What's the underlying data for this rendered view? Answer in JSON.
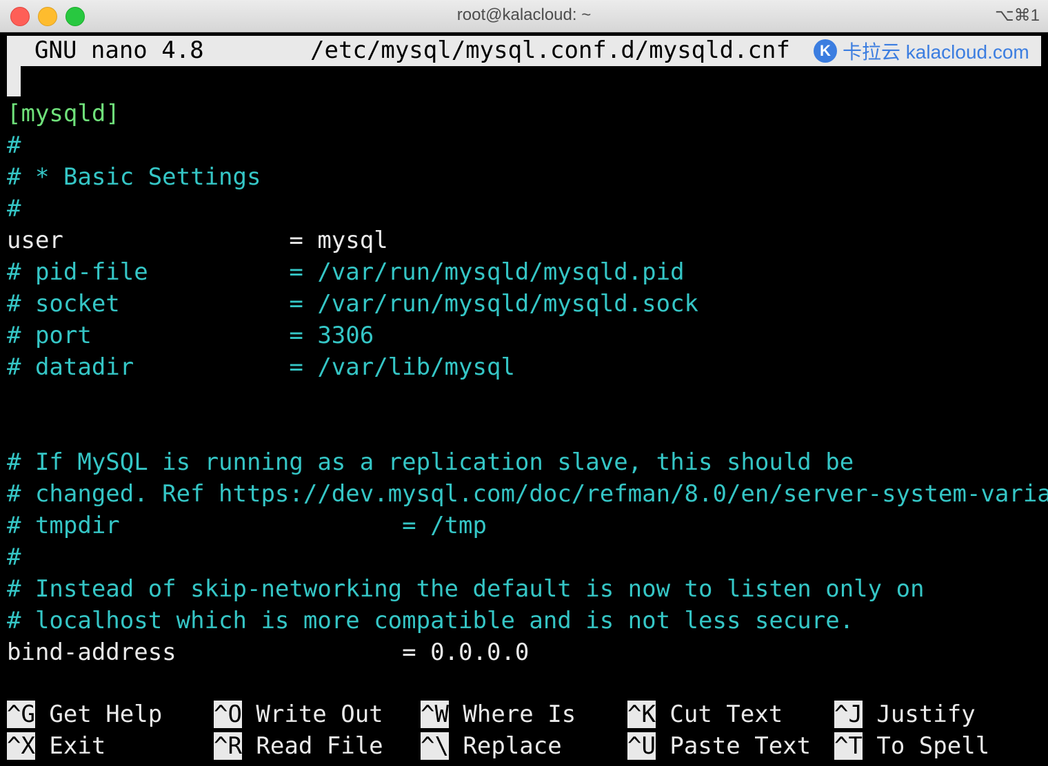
{
  "window": {
    "title": "root@kalacloud: ~",
    "shortcut": "⌥⌘1"
  },
  "nano": {
    "version_label": "GNU nano 4.8",
    "filename": "/etc/mysql/mysql.conf.d/mysqld.cnf",
    "watermark": "卡拉云 kalacloud.com"
  },
  "lines": [
    {
      "text": "",
      "color": "white"
    },
    {
      "text": "[mysqld]",
      "color": "green"
    },
    {
      "text": "#",
      "color": "cyan"
    },
    {
      "text": "# * Basic Settings",
      "color": "cyan"
    },
    {
      "text": "#",
      "color": "cyan"
    },
    {
      "text": "user                = mysql",
      "color": "white"
    },
    {
      "text": "# pid-file          = /var/run/mysqld/mysqld.pid",
      "color": "cyan"
    },
    {
      "text": "# socket            = /var/run/mysqld/mysqld.sock",
      "color": "cyan"
    },
    {
      "text": "# port              = 3306",
      "color": "cyan"
    },
    {
      "text": "# datadir           = /var/lib/mysql",
      "color": "cyan"
    },
    {
      "text": "",
      "color": "white"
    },
    {
      "text": "",
      "color": "white"
    },
    {
      "text": "# If MySQL is running as a replication slave, this should be",
      "color": "cyan"
    },
    {
      "text": "# changed. Ref https://dev.mysql.com/doc/refman/8.0/en/server-system-varia",
      "color": "cyan",
      "overflow": ">"
    },
    {
      "text": "# tmpdir                    = /tmp",
      "color": "cyan"
    },
    {
      "text": "#",
      "color": "cyan"
    },
    {
      "text": "# Instead of skip-networking the default is now to listen only on",
      "color": "cyan"
    },
    {
      "text": "# localhost which is more compatible and is not less secure.",
      "color": "cyan"
    },
    {
      "text": "bind-address                = 0.0.0.0",
      "color": "white"
    }
  ],
  "shortcuts": [
    [
      {
        "key": "^G",
        "label": "Get Help"
      },
      {
        "key": "^O",
        "label": "Write Out"
      },
      {
        "key": "^W",
        "label": "Where Is"
      },
      {
        "key": "^K",
        "label": "Cut Text"
      },
      {
        "key": "^J",
        "label": "Justify"
      }
    ],
    [
      {
        "key": "^X",
        "label": "Exit"
      },
      {
        "key": "^R",
        "label": "Read File"
      },
      {
        "key": "^\\",
        "label": "Replace"
      },
      {
        "key": "^U",
        "label": "Paste Text"
      },
      {
        "key": "^T",
        "label": "To Spell"
      }
    ]
  ],
  "colors": {
    "green": "#6fe07a",
    "cyan": "#35c6c6",
    "white": "#eaeaea"
  }
}
